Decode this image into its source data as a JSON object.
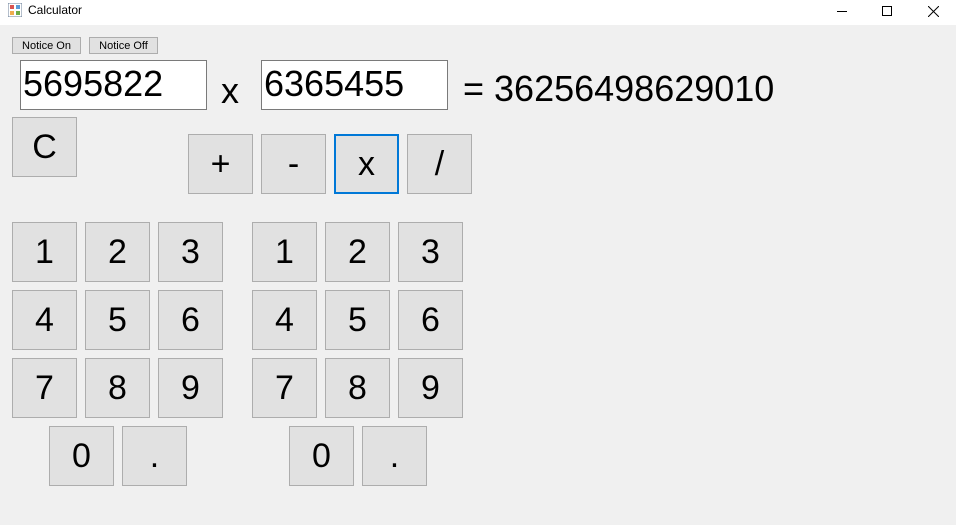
{
  "window": {
    "title": "Calculator"
  },
  "notice": {
    "on_label": "Notice On",
    "off_label": "Notice Off"
  },
  "operands": {
    "left": "5695822",
    "operator": "x",
    "right": "6365455",
    "result": "= 36256498629010"
  },
  "clear_label": "C",
  "operators": [
    "+",
    "-",
    "x",
    "/"
  ],
  "selected_operator": "x",
  "keypad_left": [
    "1",
    "2",
    "3",
    "4",
    "5",
    "6",
    "7",
    "8",
    "9",
    "0",
    "."
  ],
  "keypad_right": [
    "1",
    "2",
    "3",
    "4",
    "5",
    "6",
    "7",
    "8",
    "9",
    "0",
    "."
  ],
  "colors": {
    "background": "#f0f0f0",
    "button": "#e1e1e1",
    "button_border": "#adadad",
    "selected_border": "#0078d7"
  },
  "icons": {
    "app": "calculator-app-icon",
    "minimize": "minimize-icon",
    "maximize": "maximize-icon",
    "close": "close-icon"
  }
}
